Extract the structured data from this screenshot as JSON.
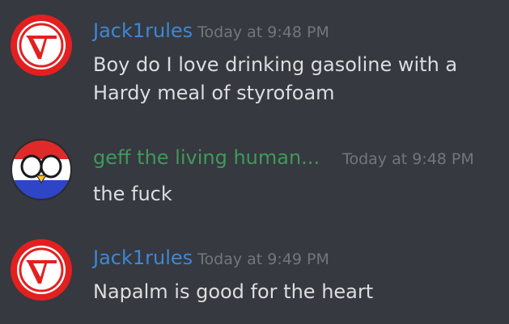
{
  "colors": {
    "background": "#36393f",
    "author_blue": "#3d88d6",
    "author_green": "#3f9a5a",
    "timestamp": "#72767d",
    "text": "#dcddde"
  },
  "messages": [
    {
      "author": "Jack1rules",
      "timestamp": "Today at 9:48 PM",
      "content": "Boy do I love drinking gasoline with a Hardy meal of styrofoam",
      "avatar_icon": "red-circle-v-logo-icon"
    },
    {
      "author": "geff the living human...",
      "timestamp": "Today at 9:48 PM",
      "content": "the fuck",
      "avatar_icon": "countryball-icon"
    },
    {
      "author": "Jack1rules",
      "timestamp": "Today at 9:49 PM",
      "content": "Napalm is good for the heart",
      "avatar_icon": "red-circle-v-logo-icon"
    }
  ]
}
